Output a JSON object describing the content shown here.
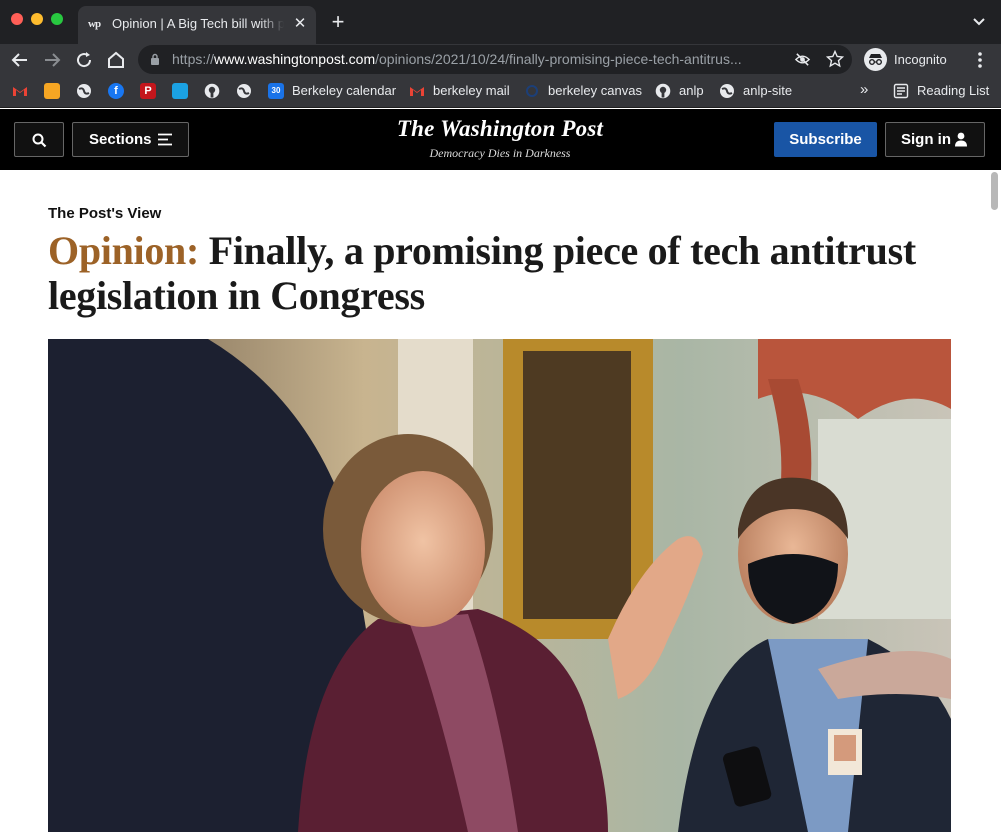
{
  "browser": {
    "tab_favicon": "wp",
    "tab_title": "Opinion | A Big Tech bill with promise",
    "url_prefix": "https://",
    "url_domain": "www.washingtonpost.com",
    "url_path": "/opinions/2021/10/24/finally-promising-piece-tech-antitrus...",
    "incognito_label": "Incognito",
    "close_glyph": "✕",
    "newtab_glyph": "+"
  },
  "bookmarks": {
    "items": [
      {
        "label": "Berkeley calendar",
        "icon": "calendar-icon"
      },
      {
        "label": "berkeley mail",
        "icon": "gmail-icon"
      },
      {
        "label": "berkeley canvas",
        "icon": "canvas-icon"
      },
      {
        "label": "anlp",
        "icon": "github-icon"
      },
      {
        "label": "anlp-site",
        "icon": "globe-icon"
      }
    ],
    "calendar_day": "30",
    "overflow": "»",
    "reading_list": "Reading List"
  },
  "site": {
    "sections_label": "Sections",
    "masthead_title": "The Washington Post",
    "masthead_tagline": "Democracy Dies in Darkness",
    "subscribe_label": "Subscribe",
    "signin_label": "Sign in"
  },
  "article": {
    "kicker": "The Post's View",
    "opinion_label": "Opinion:",
    "headline": "Finally, a promising piece of tech antitrust legislation in Congress"
  },
  "colors": {
    "opinion": "#9c6227",
    "subscribe": "#1955a5",
    "chrome_dark": "#202124",
    "chrome_toolbar": "#35363a"
  }
}
